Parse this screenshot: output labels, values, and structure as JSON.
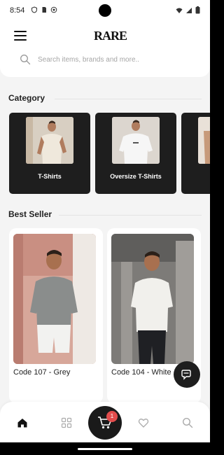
{
  "status_bar": {
    "time": "8:54"
  },
  "header": {
    "logo": "RARE"
  },
  "search": {
    "placeholder": "Search items, brands and more.."
  },
  "category": {
    "title": "Category",
    "items": [
      {
        "label": "T-Shirts"
      },
      {
        "label": "Oversize T-Shirts"
      }
    ]
  },
  "best_seller": {
    "title": "Best Seller",
    "products": [
      {
        "name": "Code 107 - Grey"
      },
      {
        "name": "Code 104 - White"
      }
    ]
  },
  "cart": {
    "count": "1"
  },
  "nav": {
    "items": [
      "home-icon",
      "grid-icon",
      "cart-icon",
      "heart-icon",
      "search-icon"
    ]
  },
  "colors": {
    "dark": "#1e1e1e",
    "badge": "#e24c4c",
    "background": "#f4f4f4"
  }
}
